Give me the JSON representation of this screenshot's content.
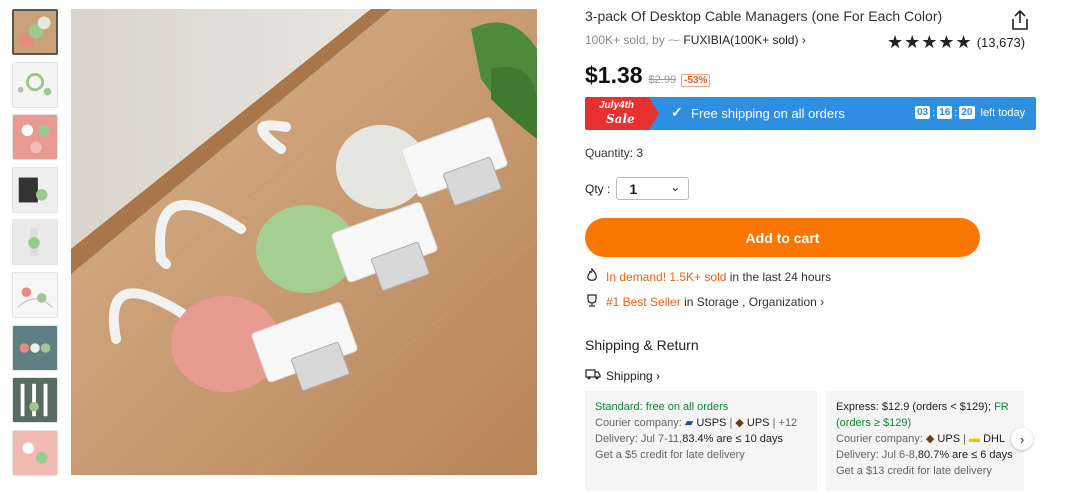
{
  "product": {
    "title": "3-pack Of Desktop Cable Managers (one For Each Color)",
    "sold": "100K+ sold, by",
    "store": "FUXIBIA(100K+ sold)",
    "rating_stars": "★★★★★",
    "rating_count": "(13,673)",
    "price": "$1.38",
    "old_price": "$2.99",
    "discount": "-53%"
  },
  "banner": {
    "sale_line1": "July4th",
    "sale_line2": "Sale",
    "shipping": "Free shipping on all orders",
    "timer_h": "03",
    "timer_m": "16",
    "timer_s": "20",
    "timer_suffix": "left today"
  },
  "quantity": {
    "label": "Quantity: 3",
    "qty_label": "Qty :",
    "value": "1"
  },
  "add_to_cart": "Add to cart",
  "demand": {
    "highlight": "In demand! 1.5K+ sold",
    "rest": "in the last 24 hours"
  },
  "best_seller": {
    "highlight": "#1 Best Seller",
    "rest": "in Storage , Organization"
  },
  "shipping": {
    "heading": "Shipping & Return",
    "link": "Shipping",
    "standard": {
      "title": "Standard: free on all orders",
      "courier_label": "Courier company:",
      "c1": "USPS",
      "c2": "UPS",
      "more": "+12",
      "delivery_prefix": "Delivery: Jul 7-11,",
      "delivery_pct": "83.4% are ≤ 10 days",
      "credit": "Get a $5 credit for late delivery"
    },
    "express": {
      "title_a": "Express: $12.9 (orders < $129);",
      "title_b": "FR",
      "title_c": "(orders ≥ $129)",
      "courier_label": "Courier company:",
      "c1": "UPS",
      "c2": "DHL",
      "delivery_prefix": "Delivery: Jul 6-8,",
      "delivery_pct": "80.7% are ≤ 6 days",
      "credit": "Get a $13 credit for late delivery"
    }
  },
  "colors": {
    "accent": "#fb7701",
    "banner_blue": "#2e8fe0",
    "sale_red": "#e8302f",
    "green_text": "#0a8a32"
  }
}
